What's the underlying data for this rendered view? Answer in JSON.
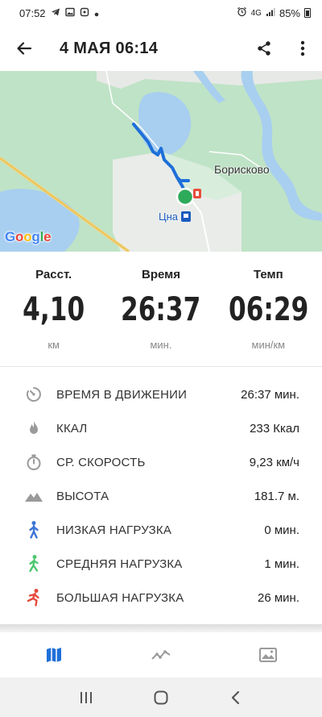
{
  "status_bar": {
    "time": "07:52",
    "network": "4G",
    "battery": "85%"
  },
  "app_bar": {
    "title": "4 МАЯ 06:14"
  },
  "map": {
    "labels": {
      "village": "Борисково",
      "station": "Цна"
    },
    "logo": "Google",
    "colors": {
      "land": "#bfe3c6",
      "water": "#a8cff0",
      "route": "#1e6fd9",
      "marker": "#2eaa5b"
    }
  },
  "stats": [
    {
      "label": "Расст.",
      "value": "4,10",
      "unit": "км"
    },
    {
      "label": "Время",
      "value": "26:37",
      "unit": "мин."
    },
    {
      "label": "Темп",
      "value": "06:29",
      "unit": "мин/км"
    }
  ],
  "details": [
    {
      "icon": "timer-icon",
      "label": "ВРЕМЯ В ДВИЖЕНИИ",
      "value": "26:37 мин."
    },
    {
      "icon": "flame-icon",
      "label": "ККАЛ",
      "value": "233 Ккал"
    },
    {
      "icon": "stopwatch-icon",
      "label": "СР. СКОРОСТЬ",
      "value": "9,23 км/ч"
    },
    {
      "icon": "mountain-icon",
      "label": "ВЫСОТА",
      "value": "181.7 м."
    },
    {
      "icon": "walker-blue-icon",
      "label": "НИЗКАЯ НАГРУЗКА",
      "value": "0 мин."
    },
    {
      "icon": "walker-green-icon",
      "label": "СРЕДНЯЯ НАГРУЗКА",
      "value": "1 мин."
    },
    {
      "icon": "runner-red-icon",
      "label": "БОЛЬШАЯ НАГРУЗКА",
      "value": "26 мин."
    }
  ],
  "tabs": [
    {
      "icon": "map-icon",
      "active": true
    },
    {
      "icon": "chart-line-icon",
      "active": false
    },
    {
      "icon": "image-icon",
      "active": false
    }
  ],
  "nav": [
    "recents-icon",
    "home-icon",
    "back-icon"
  ]
}
